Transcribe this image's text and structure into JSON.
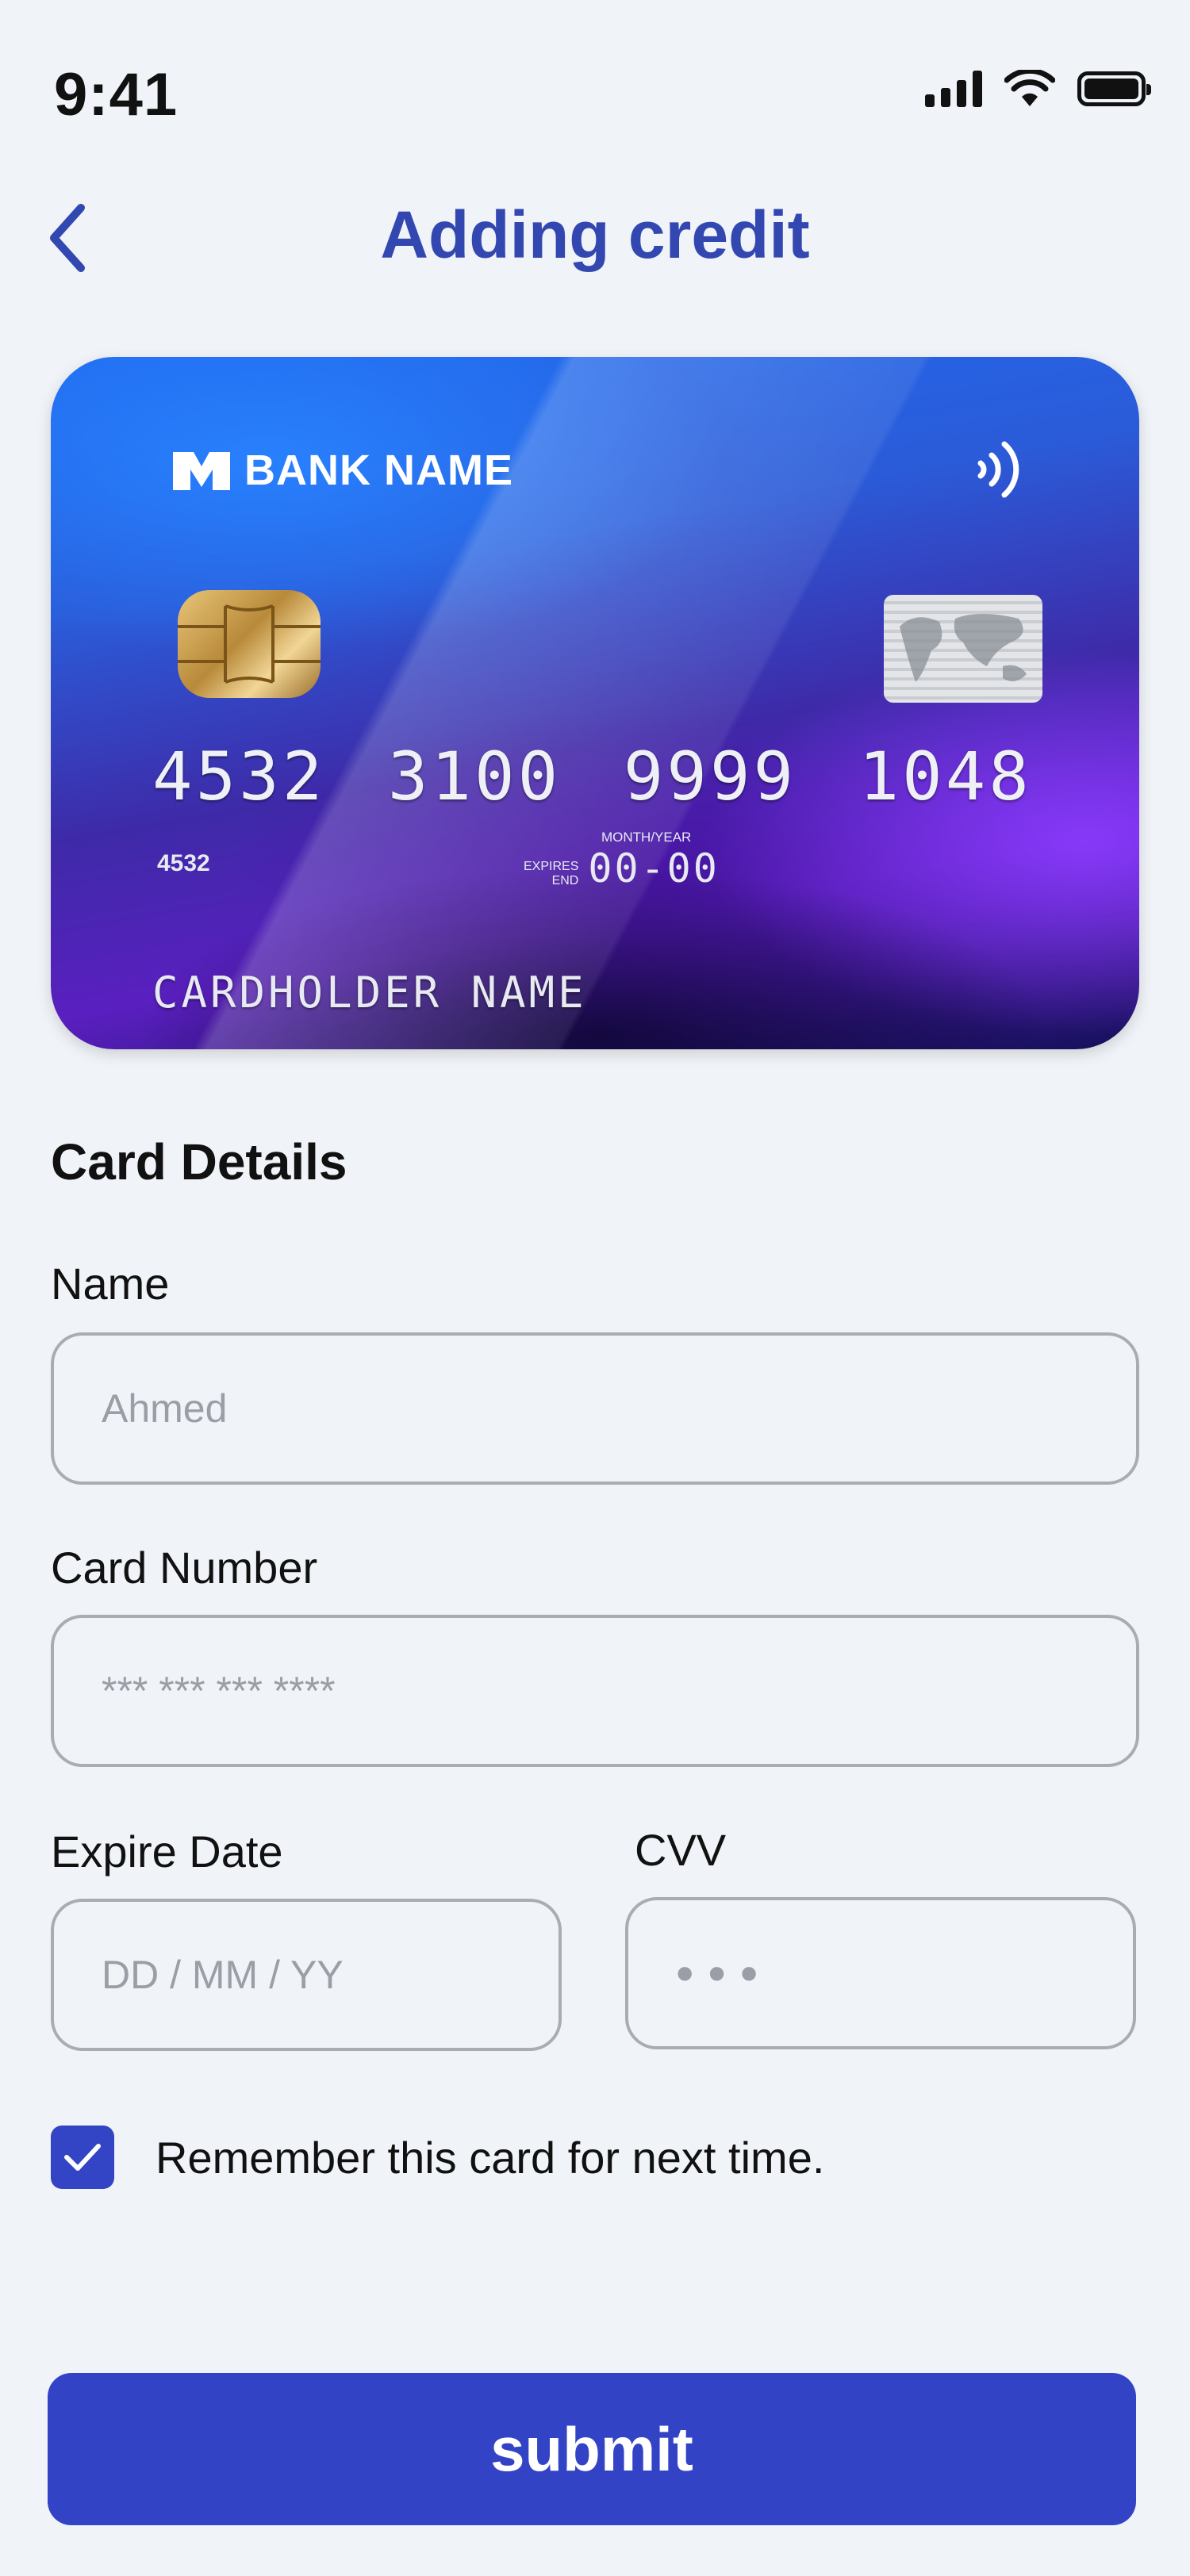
{
  "status_bar": {
    "time": "9:41"
  },
  "header": {
    "title": "Adding credit"
  },
  "card": {
    "bank_name": "BANK NAME",
    "number": "4532 3100 9999 1048",
    "small_number": "4532",
    "expires_label": "EXPIRES\nEND",
    "month_year_label": "MONTH/YEAR",
    "expiry": "00-00",
    "holder": "CARDHOLDER NAME"
  },
  "form": {
    "section_title": "Card Details",
    "name_label": "Name",
    "name_placeholder": "Ahmed",
    "card_number_label": "Card Number",
    "card_number_placeholder": "*** *** *** ****",
    "expire_label": "Expire Date",
    "expire_placeholder": "DD / MM / YY",
    "cvv_label": "CVV",
    "cvv_placeholder": "•••",
    "remember_label": "Remember this card for next time.",
    "remember_checked": true,
    "submit_label": "submit"
  },
  "colors": {
    "accent": "#3343c6",
    "title": "#3347b0",
    "background": "#f0f3f7"
  }
}
